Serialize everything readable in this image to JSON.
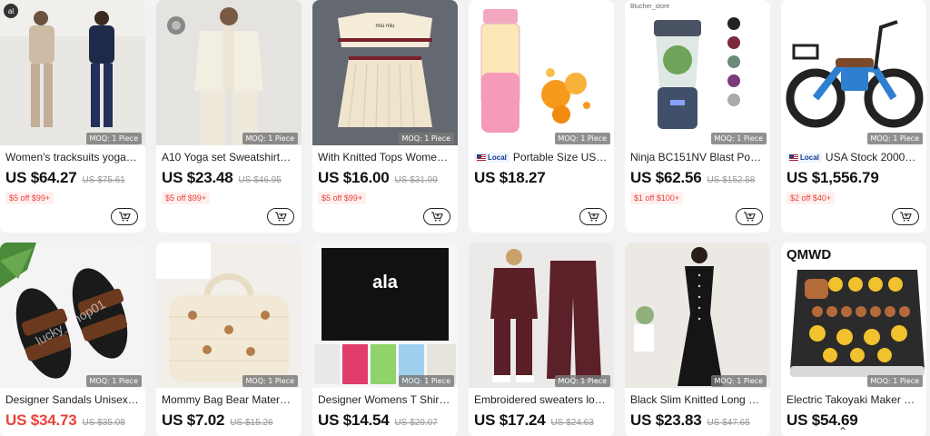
{
  "moq_label": "MOQ: 1 Piece",
  "local_label": "Local",
  "row1": [
    {
      "title": "Women's tracksuits yoga s...",
      "price": "US $64.27",
      "old": "US $75.61",
      "promo": "$5 off $99+",
      "local": false
    },
    {
      "title": "A10 Yoga set Sweatshirts ...",
      "price": "US $23.48",
      "old": "US $46.95",
      "promo": "$5 off $99+",
      "local": false
    },
    {
      "title": "With Knitted Tops Women T...",
      "price": "US $16.00",
      "old": "US $31.99",
      "promo": "$5 off $99+",
      "local": false
    },
    {
      "title": "Portable Size USB...",
      "price": "US $18.27",
      "old": "",
      "promo": "",
      "local": true
    },
    {
      "title": "Ninja BC151NV Blast Porta...",
      "price": "US $62.56",
      "old": "US $152.58",
      "promo": "$1 off $100+",
      "local": false,
      "watermark": "Blucher_store"
    },
    {
      "title": "USA Stock 2000W...",
      "price": "US $1,556.79",
      "old": "",
      "promo": "$2 off $40+",
      "local": true
    }
  ],
  "row2": [
    {
      "title": "Designer Sandals Unisex C...",
      "price": "US $34.73",
      "old": "US $35.08",
      "red": true
    },
    {
      "title": "Mommy Bag Bear Maternit...",
      "price": "US $7.02",
      "old": "US $15.26",
      "red": false
    },
    {
      "title": "Designer Womens T Shirt ...",
      "price": "US $14.54",
      "old": "US $29.07",
      "red": false
    },
    {
      "title": "Embroidered sweaters loo...",
      "price": "US $17.24",
      "old": "US $24.63",
      "red": false
    },
    {
      "title": "Black Slim Knitted Long Dr...",
      "price": "US $23.83",
      "old": "US $47.65",
      "red": false
    },
    {
      "title": "Electric Takoyaki Maker Eg...",
      "price": "US $54.69",
      "old": "",
      "red": false,
      "brand": "QMWD"
    }
  ],
  "image_text": {
    "sandal_watermark": "lucky_shop01",
    "tshirt_logo": "ala"
  },
  "colors": {
    "price_red": "#e8433a",
    "promo_bg": "#fff0ef",
    "page_bg": "#f2f2f4"
  },
  "icons": {
    "cart": "cart-icon",
    "scroll": "chevron-up-icon"
  }
}
